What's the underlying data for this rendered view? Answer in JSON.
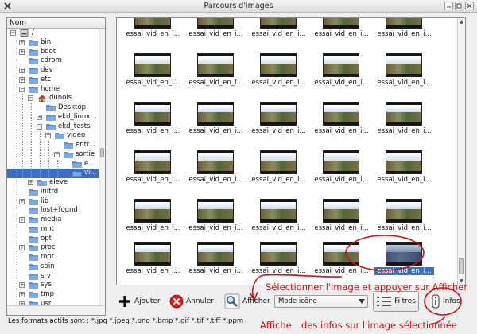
{
  "window": {
    "title": "Parcours d'images"
  },
  "tree": {
    "header": "Nom",
    "rows": [
      {
        "label": "/",
        "depth": 0,
        "expander": "−",
        "icon": "drive"
      },
      {
        "label": "bin",
        "depth": 1,
        "expander": "+",
        "icon": "folder"
      },
      {
        "label": "boot",
        "depth": 1,
        "expander": "+",
        "icon": "folder"
      },
      {
        "label": "cdrom",
        "depth": 1,
        "expander": "",
        "icon": "folder"
      },
      {
        "label": "dev",
        "depth": 1,
        "expander": "+",
        "icon": "folder"
      },
      {
        "label": "etc",
        "depth": 1,
        "expander": "+",
        "icon": "folder"
      },
      {
        "label": "home",
        "depth": 1,
        "expander": "−",
        "icon": "folder"
      },
      {
        "label": "dunois",
        "depth": 2,
        "expander": "−",
        "icon": "home"
      },
      {
        "label": "Desktop",
        "depth": 3,
        "expander": "",
        "icon": "folder"
      },
      {
        "label": "ekd_linux...",
        "depth": 3,
        "expander": "+",
        "icon": "folder"
      },
      {
        "label": "ekd_tests",
        "depth": 3,
        "expander": "−",
        "icon": "folder"
      },
      {
        "label": "video",
        "depth": 4,
        "expander": "−",
        "icon": "folder"
      },
      {
        "label": "entr...",
        "depth": 5,
        "expander": "",
        "icon": "folder"
      },
      {
        "label": "sortie",
        "depth": 5,
        "expander": "−",
        "icon": "folder"
      },
      {
        "label": "e...",
        "depth": 6,
        "expander": "",
        "icon": "folder"
      },
      {
        "label": "vi...",
        "depth": 6,
        "expander": "",
        "icon": "folder",
        "selected": true
      },
      {
        "label": "eleve",
        "depth": 2,
        "expander": "+",
        "icon": "folder"
      },
      {
        "label": "initrd",
        "depth": 1,
        "expander": "",
        "icon": "folder"
      },
      {
        "label": "lib",
        "depth": 1,
        "expander": "+",
        "icon": "folder"
      },
      {
        "label": "lost+found",
        "depth": 1,
        "expander": "",
        "icon": "folder"
      },
      {
        "label": "media",
        "depth": 1,
        "expander": "+",
        "icon": "folder"
      },
      {
        "label": "mnt",
        "depth": 1,
        "expander": "",
        "icon": "folder"
      },
      {
        "label": "opt",
        "depth": 1,
        "expander": "",
        "icon": "folder"
      },
      {
        "label": "proc",
        "depth": 1,
        "expander": "+",
        "icon": "folder"
      },
      {
        "label": "root",
        "depth": 1,
        "expander": "",
        "icon": "folder"
      },
      {
        "label": "sbin",
        "depth": 1,
        "expander": "",
        "icon": "folder"
      },
      {
        "label": "srv",
        "depth": 1,
        "expander": "",
        "icon": "folder"
      },
      {
        "label": "sys",
        "depth": 1,
        "expander": "+",
        "icon": "folder"
      },
      {
        "label": "tmp",
        "depth": 1,
        "expander": "+",
        "icon": "folder"
      },
      {
        "label": "usr",
        "depth": 1,
        "expander": "+",
        "icon": "folder"
      }
    ]
  },
  "grid": {
    "thumbnail_label": "essai_vid_en_i...",
    "rows": 6,
    "cols": 5,
    "selected_index": 29
  },
  "toolbar": {
    "add_label": "Ajouter",
    "cancel_label": "Annuler",
    "show_label": "Afficher",
    "mode_value": "Mode icône",
    "filters_label": "Filtres",
    "info_label": "Infos"
  },
  "status": {
    "formats": "Les formats actifs sont : *.jpg *.jpeg *.png *.bmp *.gif *.tif *.tiff *.ppm"
  },
  "annotations": {
    "select_hint": "Sélectionner l'image et appuyer sur Afficher",
    "info_hint_a": "Affiche",
    "info_hint_b": "des infos sur l'image sélectionnée"
  },
  "colors": {
    "selection": "#3a6fc2",
    "annotation": "#d01010",
    "folder": "#5b8fd6"
  }
}
